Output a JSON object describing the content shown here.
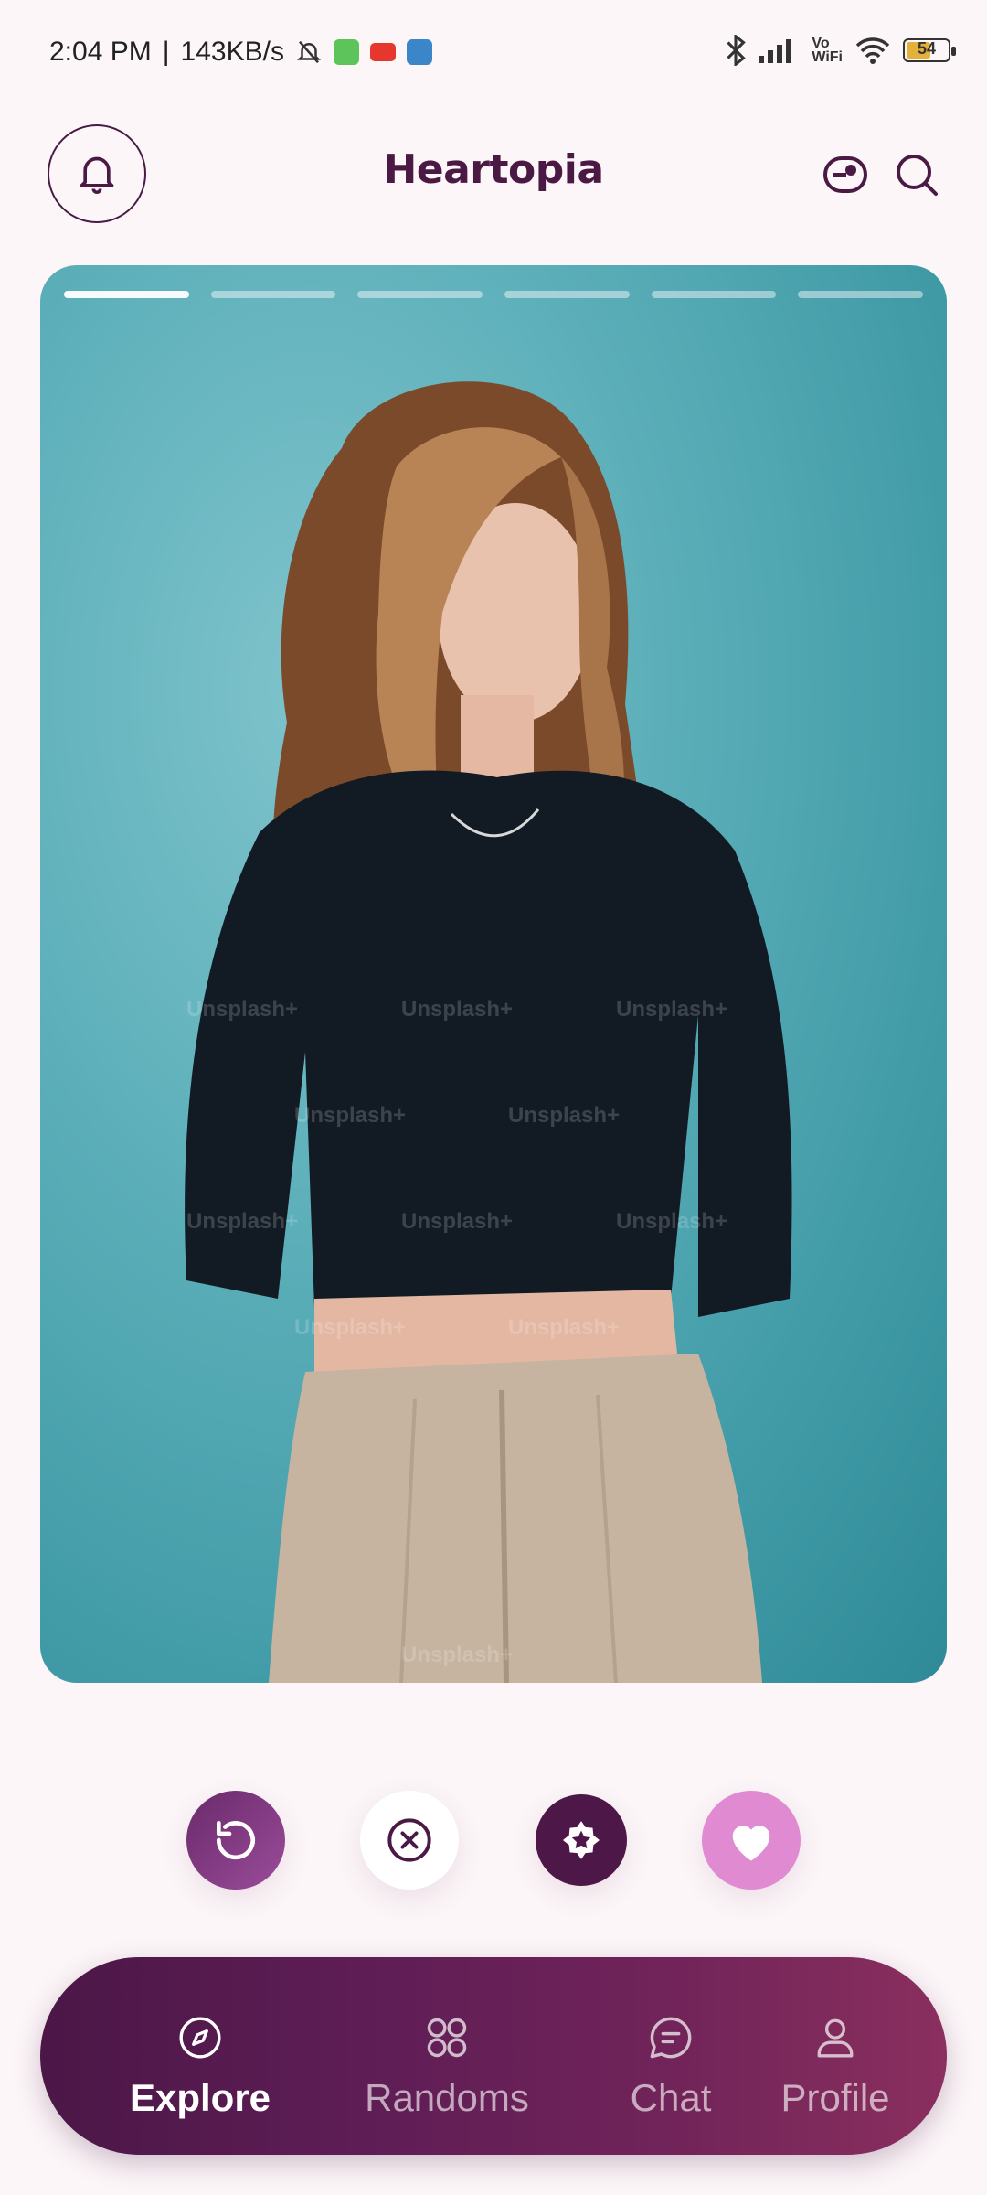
{
  "status_bar": {
    "time": "2:04 PM",
    "speed": "143KB/s",
    "battery_level": "54",
    "vowifi_top": "Vo",
    "vowifi_bottom": "WiFi"
  },
  "header": {
    "app_name": "Heartopia",
    "icons": [
      "bell-icon",
      "toggle-icon",
      "search-icon"
    ]
  },
  "card": {
    "photo_index": 1,
    "photo_count": 6,
    "watermark": "Unsplash+",
    "colors": {
      "background": "#5fb1bb",
      "top": "#121a24",
      "pants": "#c6b4a0",
      "hair": "#7a4a2a"
    }
  },
  "actions": [
    {
      "name": "undo",
      "icon": "rotate-ccw-icon",
      "color": "#7a327a"
    },
    {
      "name": "nope",
      "icon": "x-circle-icon",
      "color": "#ffffff"
    },
    {
      "name": "super-like",
      "icon": "star-badge-icon",
      "color": "#4d1747"
    },
    {
      "name": "like",
      "icon": "heart-icon",
      "color": "#e08ad2"
    }
  ],
  "nav": {
    "items": [
      {
        "label": "Explore",
        "icon": "compass-icon",
        "active": true
      },
      {
        "label": "Randoms",
        "icon": "grid-icon",
        "active": false
      },
      {
        "label": "Chat",
        "icon": "chat-icon",
        "active": false
      },
      {
        "label": "Profile",
        "icon": "person-icon",
        "active": false
      }
    ]
  },
  "theme": {
    "accent": "#4a1a45",
    "background": "#fcf6f8"
  }
}
